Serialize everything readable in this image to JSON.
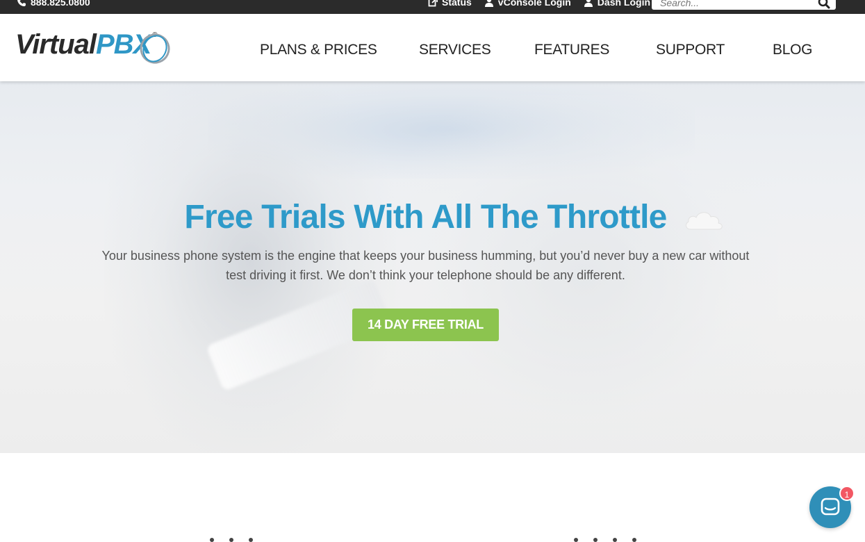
{
  "topbar": {
    "phone": "888.825.0800",
    "links": [
      {
        "label": "Status",
        "icon": "external-icon"
      },
      {
        "label": "vConsole Login",
        "icon": "user-icon"
      },
      {
        "label": "Dash Login",
        "icon": "user-icon"
      }
    ],
    "search_placeholder": "Search..."
  },
  "header": {
    "logo_part1": "Virtual",
    "logo_part2": "PBX",
    "logo_reg": "®",
    "nav": [
      "PLANS & PRICES",
      "SERVICES",
      "FEATURES",
      "SUPPORT",
      "BLOG"
    ]
  },
  "hero": {
    "title": "Free Trials With All The Throttle",
    "body": "Your business phone system is the engine that keeps your business humming, but you’d never buy a new car without test driving it first. We don’t think your telephone should be any different.",
    "cta": "14 DAY FREE TRIAL"
  },
  "chat": {
    "badge": "1"
  },
  "colors": {
    "accent_blue": "#2e9ac9",
    "cta_green": "#8cc44f",
    "topbar": "#2b2b2b",
    "badge_red": "#f25763"
  }
}
